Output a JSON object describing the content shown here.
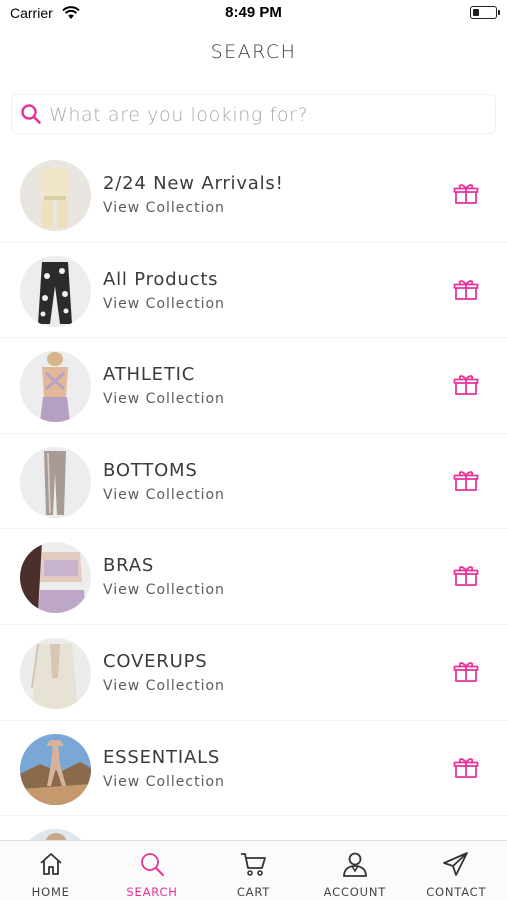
{
  "status": {
    "carrier": "Carrier",
    "time": "8:49 PM"
  },
  "header": {
    "title": "SEARCH"
  },
  "search": {
    "placeholder": "What are you looking for?"
  },
  "collections": [
    {
      "title": "2/24 New Arrivals!",
      "subtitle": "View Collection"
    },
    {
      "title": "All Products",
      "subtitle": "View Collection"
    },
    {
      "title": "ATHLETIC",
      "subtitle": "View Collection"
    },
    {
      "title": "BOTTOMS",
      "subtitle": "View Collection"
    },
    {
      "title": "BRAS",
      "subtitle": "View Collection"
    },
    {
      "title": "COVERUPS",
      "subtitle": "View Collection"
    },
    {
      "title": "ESSENTIALS",
      "subtitle": "View Collection"
    },
    {
      "title": "",
      "subtitle": ""
    }
  ],
  "nav": {
    "items": [
      {
        "label": "HOME",
        "icon": "home-icon"
      },
      {
        "label": "SEARCH",
        "icon": "search-icon",
        "active": true
      },
      {
        "label": "CART",
        "icon": "cart-icon"
      },
      {
        "label": "ACCOUNT",
        "icon": "account-icon"
      },
      {
        "label": "CONTACT",
        "icon": "paper-plane-icon"
      }
    ]
  },
  "colors": {
    "accent": "#e8329a",
    "text": "#3b3b3b",
    "muted": "#a8a8a8"
  }
}
